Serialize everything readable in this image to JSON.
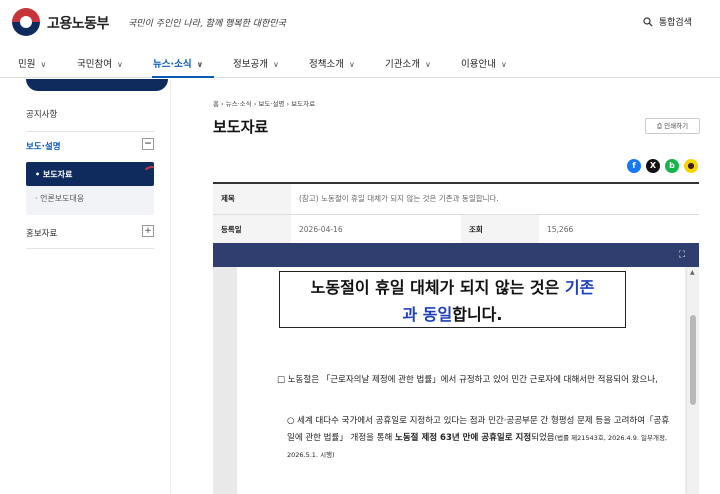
{
  "header": {
    "brand": "고용노동부",
    "slogan": "국민이 주인인 나라, 함께 행복한 대한민국",
    "search_label": "통합검색"
  },
  "nav": {
    "items": [
      {
        "label": "민원"
      },
      {
        "label": "국민참여"
      },
      {
        "label": "뉴스·소식"
      },
      {
        "label": "정보공개"
      },
      {
        "label": "정책소개"
      },
      {
        "label": "기관소개"
      },
      {
        "label": "이용안내"
      }
    ],
    "active_index": 2
  },
  "sidebar": {
    "items": [
      {
        "label": "공지사항"
      },
      {
        "label": "보도·설명",
        "toggle": "−"
      },
      {
        "label": "홍보자료",
        "toggle": "+"
      }
    ],
    "subitems": [
      {
        "label": "• 보도자료"
      },
      {
        "label": "· 언론보도대응"
      }
    ]
  },
  "main": {
    "breadcrumb": "홈 › 뉴스·소식 › 보도·설명 › 보도자료",
    "title": "보도자료",
    "print_label": "인쇄하기",
    "share": [
      {
        "icon": "facebook-icon",
        "glyph": "f",
        "color": "#1877f2"
      },
      {
        "icon": "x-icon",
        "glyph": "X",
        "color": "#111111"
      },
      {
        "icon": "band-icon",
        "glyph": "b",
        "color": "#15b54a"
      },
      {
        "icon": "kakaotalk-icon",
        "glyph": "●",
        "color": "#f7d500"
      }
    ],
    "info": {
      "subject_label": "제목",
      "subject": "(참고) 노동절이 휴일 대체가 되지 않는 것은 기존과 동일합니다.",
      "date_label": "등록일",
      "date": "2026-04-16",
      "views_label": "조회",
      "views": "15,266"
    }
  },
  "document": {
    "title_part1": "노동절이 휴일 대체가 되지 않는 것은 ",
    "title_hl1": "기존",
    "title_hl2": "과 동일",
    "title_part2": "합니다.",
    "para1": "□ 노동절은 「근로자의날 제정에 관한 법률」에서 규정하고 있어 민간 근로자에 대해서만 적용되어 왔으나,",
    "para2_a": "○ 세계 대다수 국가에서 공휴일로 지정하고 있다는 점과 민간·공공부문 간 형평성 문제 등을 고려하여「공휴일에 관한 법률」 개정을 통해 ",
    "para2_b": "노동절 제정 63년 만에 공휴일로 지정",
    "para2_c": "되었음",
    "para2_small": "(법률 제21543호, 2026.4.9. 일부개정, 2026.5.1. 시행)"
  },
  "colors": {
    "accent": "#0a5bb3",
    "navy": "#0f2a5c",
    "viewer_bar": "#2f3e6f",
    "highlight": "#1e3fb8"
  }
}
